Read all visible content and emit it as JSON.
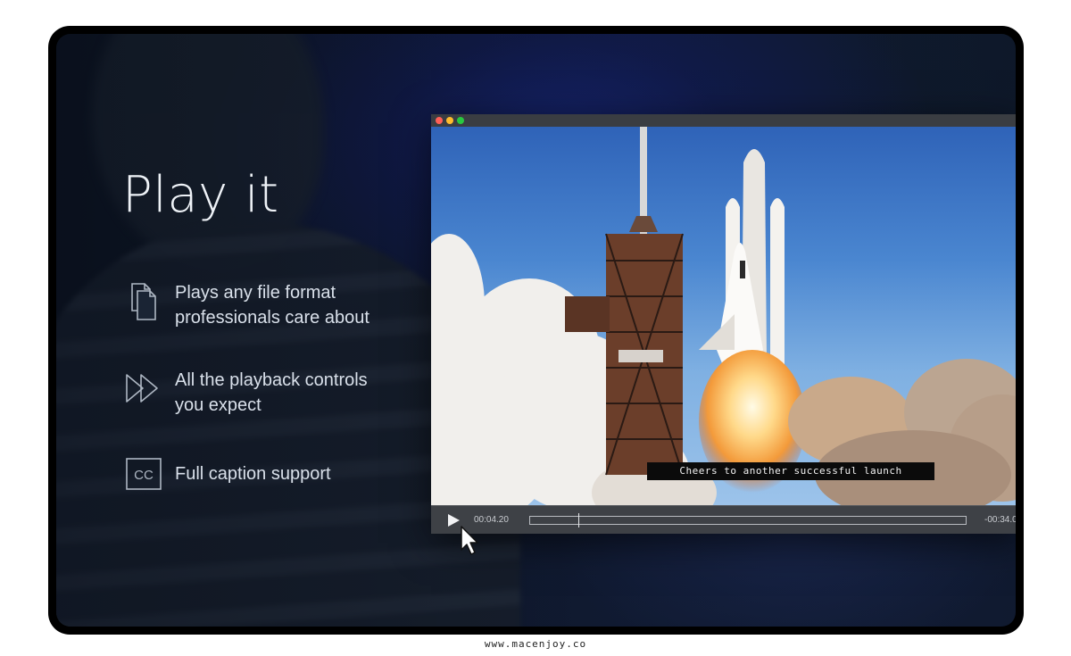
{
  "headline": "Play it",
  "features": [
    {
      "icon": "documents-icon",
      "line1": "Plays any file format",
      "line2": "professionals care about"
    },
    {
      "icon": "fast-forward-icon",
      "line1": "All the playback controls",
      "line2": "you expect"
    },
    {
      "icon": "closed-caption-icon",
      "line1": "Full caption support",
      "badge": "CC"
    }
  ],
  "player": {
    "window_dots": [
      "#ff5f57",
      "#febc2e",
      "#28c840"
    ],
    "subtitle": "Cheers to another successful launch",
    "current_time": "00:04.20",
    "remaining_time": "-00:34.0",
    "progress": 0.11
  },
  "footer": {
    "url": "www.macenjoy.co"
  }
}
